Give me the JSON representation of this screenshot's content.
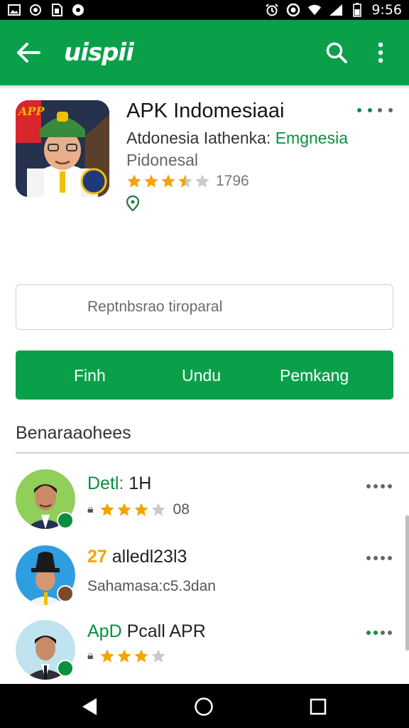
{
  "status_bar": {
    "time": "9:56",
    "icons": [
      "gallery-icon",
      "sync-icon",
      "sim-icon",
      "notification-icon",
      "alarm-icon",
      "ring-icon",
      "wifi-icon",
      "signal-icon",
      "battery-icon"
    ]
  },
  "toolbar": {
    "logo": "uispii",
    "icons": [
      "back-arrow-icon",
      "search-icon",
      "more-vert-icon"
    ]
  },
  "app": {
    "icon_badge": "APP",
    "title": "APK Indomesiaai",
    "developer_prefix": "Atdonesia Iathenka: ",
    "developer_accent": "Emgnesia",
    "subtitle": "Pidonesal",
    "rating": 3.5,
    "rating_count": "1796",
    "accent_color": "#0aa04a"
  },
  "search": {
    "placeholder": "Reptnbsrao tiroparal"
  },
  "actions": {
    "left": "Finh",
    "center": "Undu",
    "right": "Pemkang"
  },
  "section": {
    "title": "Benaraaohees"
  },
  "items": [
    {
      "title_accent": "Detl:",
      "title_rest": " 1H",
      "stars": 3,
      "meta": "08"
    },
    {
      "title_accent": "27",
      "title_rest": " alledl23l3",
      "meta": "Sahamasa:c5.3dan"
    },
    {
      "title_accent": "ApD",
      "title_rest": " Pcall APR",
      "stars": 3
    }
  ]
}
